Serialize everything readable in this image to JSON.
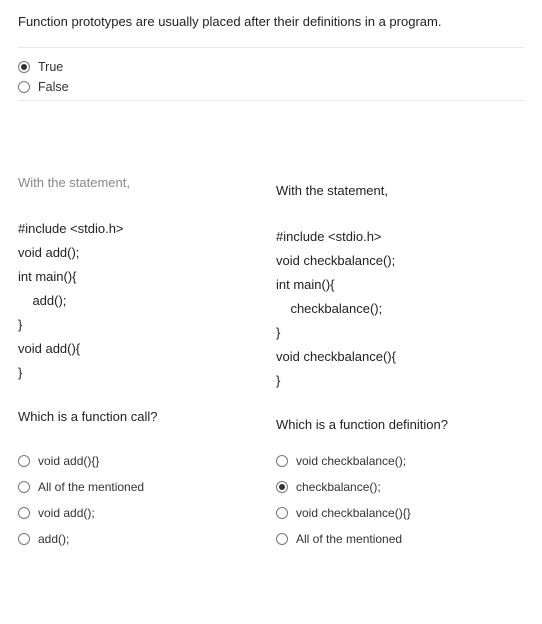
{
  "q1": {
    "prompt": "Function prototypes are usually placed after their definitions in a program.",
    "options": [
      {
        "label": "True",
        "selected": true
      },
      {
        "label": "False",
        "selected": false
      }
    ]
  },
  "q2": {
    "left": {
      "header": "With the statement,",
      "code": [
        "#include <stdio.h>",
        "void add();",
        "int main(){",
        "    add();",
        "}",
        "void add(){",
        "}"
      ],
      "sub_prompt": "Which is a function call?",
      "options": [
        {
          "label": "void add(){}",
          "selected": false
        },
        {
          "label": "All of the mentioned",
          "selected": false
        },
        {
          "label": "void add();",
          "selected": false
        },
        {
          "label": "add();",
          "selected": false
        }
      ]
    },
    "right": {
      "header": "With the statement,",
      "code": [
        "#include <stdio.h>",
        "void checkbalance();",
        "int main(){",
        "    checkbalance();",
        "}",
        "void checkbalance(){",
        "}"
      ],
      "sub_prompt": "Which is a function definition?",
      "options": [
        {
          "label": "void checkbalance();",
          "selected": false
        },
        {
          "label": "checkbalance();",
          "selected": true
        },
        {
          "label": "void checkbalance(){}",
          "selected": false
        },
        {
          "label": "All of the mentioned",
          "selected": false
        }
      ]
    }
  }
}
